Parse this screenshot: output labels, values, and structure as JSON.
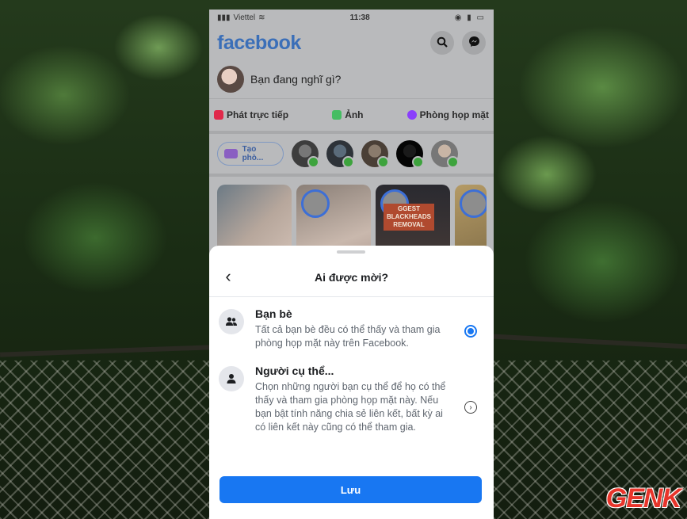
{
  "status_bar": {
    "carrier": "Viettel",
    "time": "11:38"
  },
  "header": {
    "logo": "facebook",
    "icons": [
      "search-icon",
      "messenger-icon"
    ]
  },
  "composer": {
    "placeholder": "Bạn đang nghĩ gì?"
  },
  "actions": [
    {
      "label": "Phát trực tiếp",
      "icon": "live-video-icon",
      "color": "#e0294a"
    },
    {
      "label": "Ảnh",
      "icon": "photo-icon",
      "color": "#45bd62"
    },
    {
      "label": "Phòng họp mặt",
      "icon": "room-icon",
      "color": "#8a3ffc"
    }
  ],
  "rooms": {
    "create_label": "Tạo phò..."
  },
  "stories": {
    "story3_text": "GGEST BLACKHEADS REMOVAL"
  },
  "sheet": {
    "title": "Ai được mời?",
    "options": [
      {
        "title": "Bạn bè",
        "description": "Tất cả bạn bè đều có thể thấy và tham gia phòng họp mặt này trên Facebook.",
        "icon": "friends-icon",
        "selected": true
      },
      {
        "title": "Người cụ thể...",
        "description": "Chọn những người bạn cụ thể để họ có thể thấy và tham gia phòng họp mặt này. Nếu bạn bật tính năng chia sẻ liên kết, bất kỳ ai có liên kết này cũng có thể tham gia.",
        "icon": "person-icon",
        "selected": false
      }
    ],
    "save_label": "Lưu"
  },
  "watermark": "GENK",
  "colors": {
    "facebook_blue": "#1877f2",
    "logo_blue": "#3b6fb8",
    "watermark_red": "#e8352b"
  }
}
